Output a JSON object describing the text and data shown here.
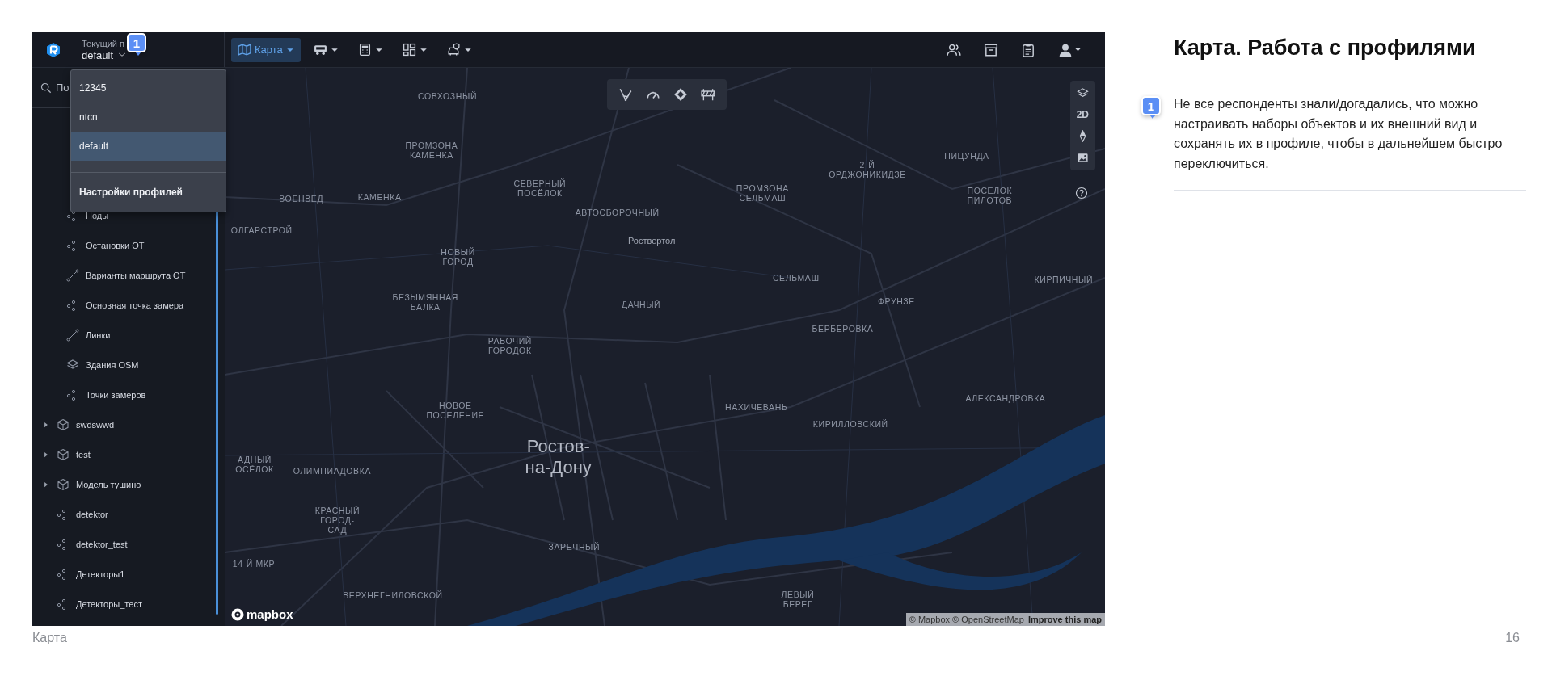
{
  "app": {
    "profile": {
      "label": "Текущий п",
      "value": "default"
    },
    "toolbar": {
      "menus": [
        {
          "kind": "map",
          "label": "Карта",
          "selected": true
        },
        {
          "kind": "bus",
          "selected": false
        },
        {
          "kind": "calculator",
          "selected": false
        },
        {
          "kind": "dashboard",
          "selected": false
        },
        {
          "kind": "car",
          "selected": false
        }
      ],
      "right": [
        {
          "kind": "users"
        },
        {
          "kind": "archive"
        },
        {
          "kind": "clipboard"
        },
        {
          "kind": "user"
        }
      ]
    },
    "profile_menu": {
      "items": [
        {
          "label": "12345",
          "selected": false
        },
        {
          "label": "ntcn",
          "selected": false
        },
        {
          "label": "default",
          "selected": true
        }
      ],
      "settings": "Настройки профилей"
    },
    "sidebar": {
      "search": {
        "placeholder": "По"
      },
      "layers": [
        {
          "children": [
            {
              "label": "Ноды",
              "kind": "points"
            },
            {
              "label": "Остановки ОТ",
              "kind": "points"
            },
            {
              "label": "Варианты маршрута ОТ",
              "kind": "line"
            },
            {
              "label": "Основная точка замера",
              "kind": "points"
            },
            {
              "label": "Линки",
              "kind": "line"
            },
            {
              "label": "Здания OSM",
              "kind": "layers"
            },
            {
              "label": "Точки замеров",
              "kind": "points"
            }
          ]
        },
        {
          "label": "swdswwd",
          "kind": "model",
          "expanded": false
        },
        {
          "label": "test",
          "kind": "model",
          "expanded": false
        },
        {
          "label": "Модель тушино",
          "kind": "model",
          "expanded": false
        },
        {
          "label": "detektor",
          "kind": "points"
        },
        {
          "label": "detektor_test",
          "kind": "points"
        },
        {
          "label": "Детекторы1",
          "kind": "points"
        },
        {
          "label": "Детекторы_тест",
          "kind": "points"
        }
      ]
    },
    "map": {
      "tools": [
        {
          "kind": "angle"
        },
        {
          "kind": "gauge"
        },
        {
          "kind": "diamond"
        },
        {
          "kind": "barrier"
        }
      ],
      "controls": [
        {
          "kind": "layers"
        },
        {
          "kind": "text",
          "label": "2D"
        },
        {
          "kind": "compass"
        },
        {
          "kind": "image"
        }
      ],
      "labels": [
        "СОВХОЗНЫЙ",
        "ПРОМЗОНА КАМЕНКА",
        "ВОЕНВЕД",
        "КАМЕНКА",
        "ОЛГАРСТРОЙ",
        "СЕВЕРНЫЙ ПОСЁЛОК",
        "АВТОСБОРОЧНЫЙ",
        "Роствертол",
        "ПРОМЗОНА СЕЛЬМАШ",
        "2-Й ОРДЖОНИКИДЗЕ",
        "ПИЦУНДА",
        "ПОСЕЛОК ПИЛОТОВ",
        "НОВЫЙ ГОРОД",
        "СЕЛЬМАШ",
        "ФРУНЗЕ",
        "КИРПИЧНЫЙ",
        "БЕЗЫМЯННАЯ БАЛКА",
        "ДАЧНЫЙ",
        "БЕРБЕРОВКА",
        "РАБОЧИЙ ГОРОДОК",
        "АЛЕКСАНДРОВКА",
        "НАХИЧЕВАНЬ",
        "КИРИЛЛОВСКИЙ",
        "НОВОЕ ПОСЕЛЕНИЕ",
        "АДНЫЙ ОСЁЛОК",
        "ОЛИМПИАДОВКА",
        "Ростов-на-Дону",
        "КРАСНЫЙ ГОРОД-САД",
        "ЗАРЕЧНЫЙ",
        "14-Й МКР",
        "ВЕРХНЕГНИЛОВСКОЙ",
        "ЛЕВЫЙ БЕРЕГ"
      ],
      "logo": "mapbox",
      "attribution": "© Mapbox © OpenStreetMap",
      "improve_link": "Improve this map"
    }
  },
  "notes": {
    "title": "Карта. Работа с профилями",
    "items": [
      {
        "marker": "1",
        "text": "Не все респонденты знали/догадались, что можно настраивать наборы объектов и их внешний вид и сохранять их в профиле, чтобы в дальнейшем быстро переключиться."
      }
    ]
  },
  "app_marker": "1",
  "footer": {
    "section": "Карта",
    "page": "16"
  }
}
